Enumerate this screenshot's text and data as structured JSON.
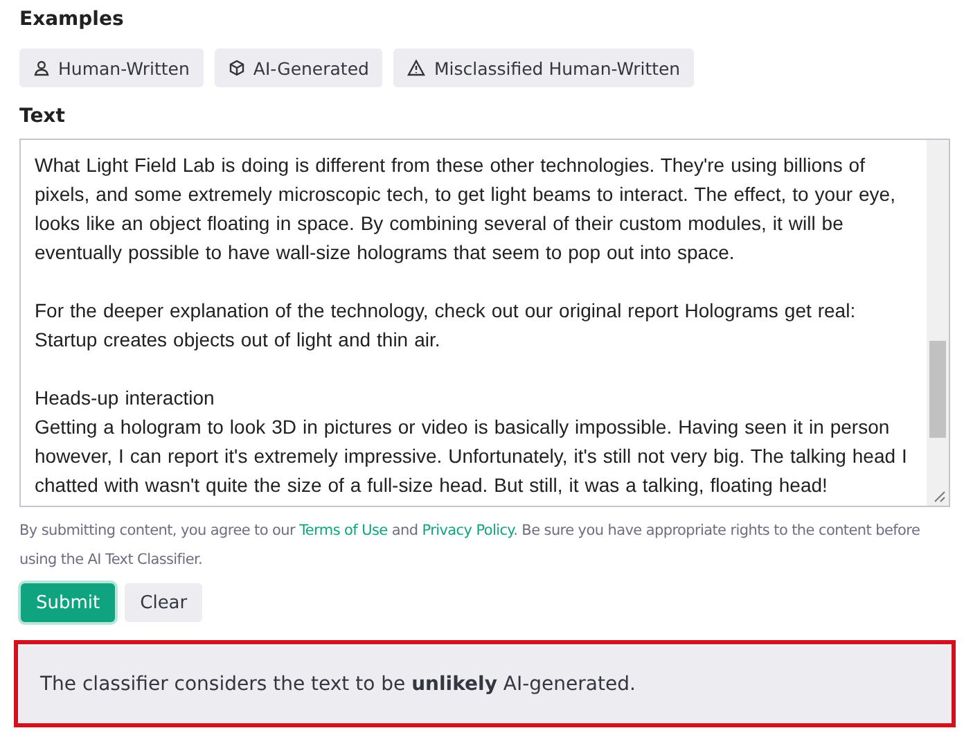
{
  "examples": {
    "heading": "Examples",
    "items": [
      {
        "label": "Human-Written",
        "kind": "person"
      },
      {
        "label": "AI-Generated",
        "kind": "cube"
      },
      {
        "label": "Misclassified Human-Written",
        "kind": "warning"
      }
    ]
  },
  "text_field": {
    "label": "Text",
    "paragraphs": [
      "What Light Field Lab is doing is different from these other technologies. They're using billions of pixels, and some extremely microscopic tech, to get light beams to interact. The effect, to your eye, looks like an object floating in space. By combining several of their custom modules, it will be eventually possible to have wall-size holograms that seem to pop out into space.",
      "For the deeper explanation of the technology, check out our original report Holograms get real: Startup creates objects out of light and thin air.",
      "Heads-up interaction\nGetting a hologram to look 3D in pictures or video is basically impossible. Having seen it in person however, I can report it's extremely impressive. Unfortunately, it's still not very big. The talking head I chatted with wasn't quite the size of a full-size head. But still, it was a talking, floating head!"
    ]
  },
  "notice": {
    "before": "By submitting content, you agree to our ",
    "terms_link": "Terms of Use",
    "middle": " and ",
    "privacy_link": "Privacy Policy",
    "after": ". Be sure you have appropriate rights to the content before using the AI Text Classifier."
  },
  "buttons": [
    {
      "label": "Submit",
      "kind": "primary"
    },
    {
      "label": "Clear",
      "kind": "secondary"
    }
  ],
  "result": {
    "text": "The classifier considers the text to be **unlikely** AI-generated."
  }
}
